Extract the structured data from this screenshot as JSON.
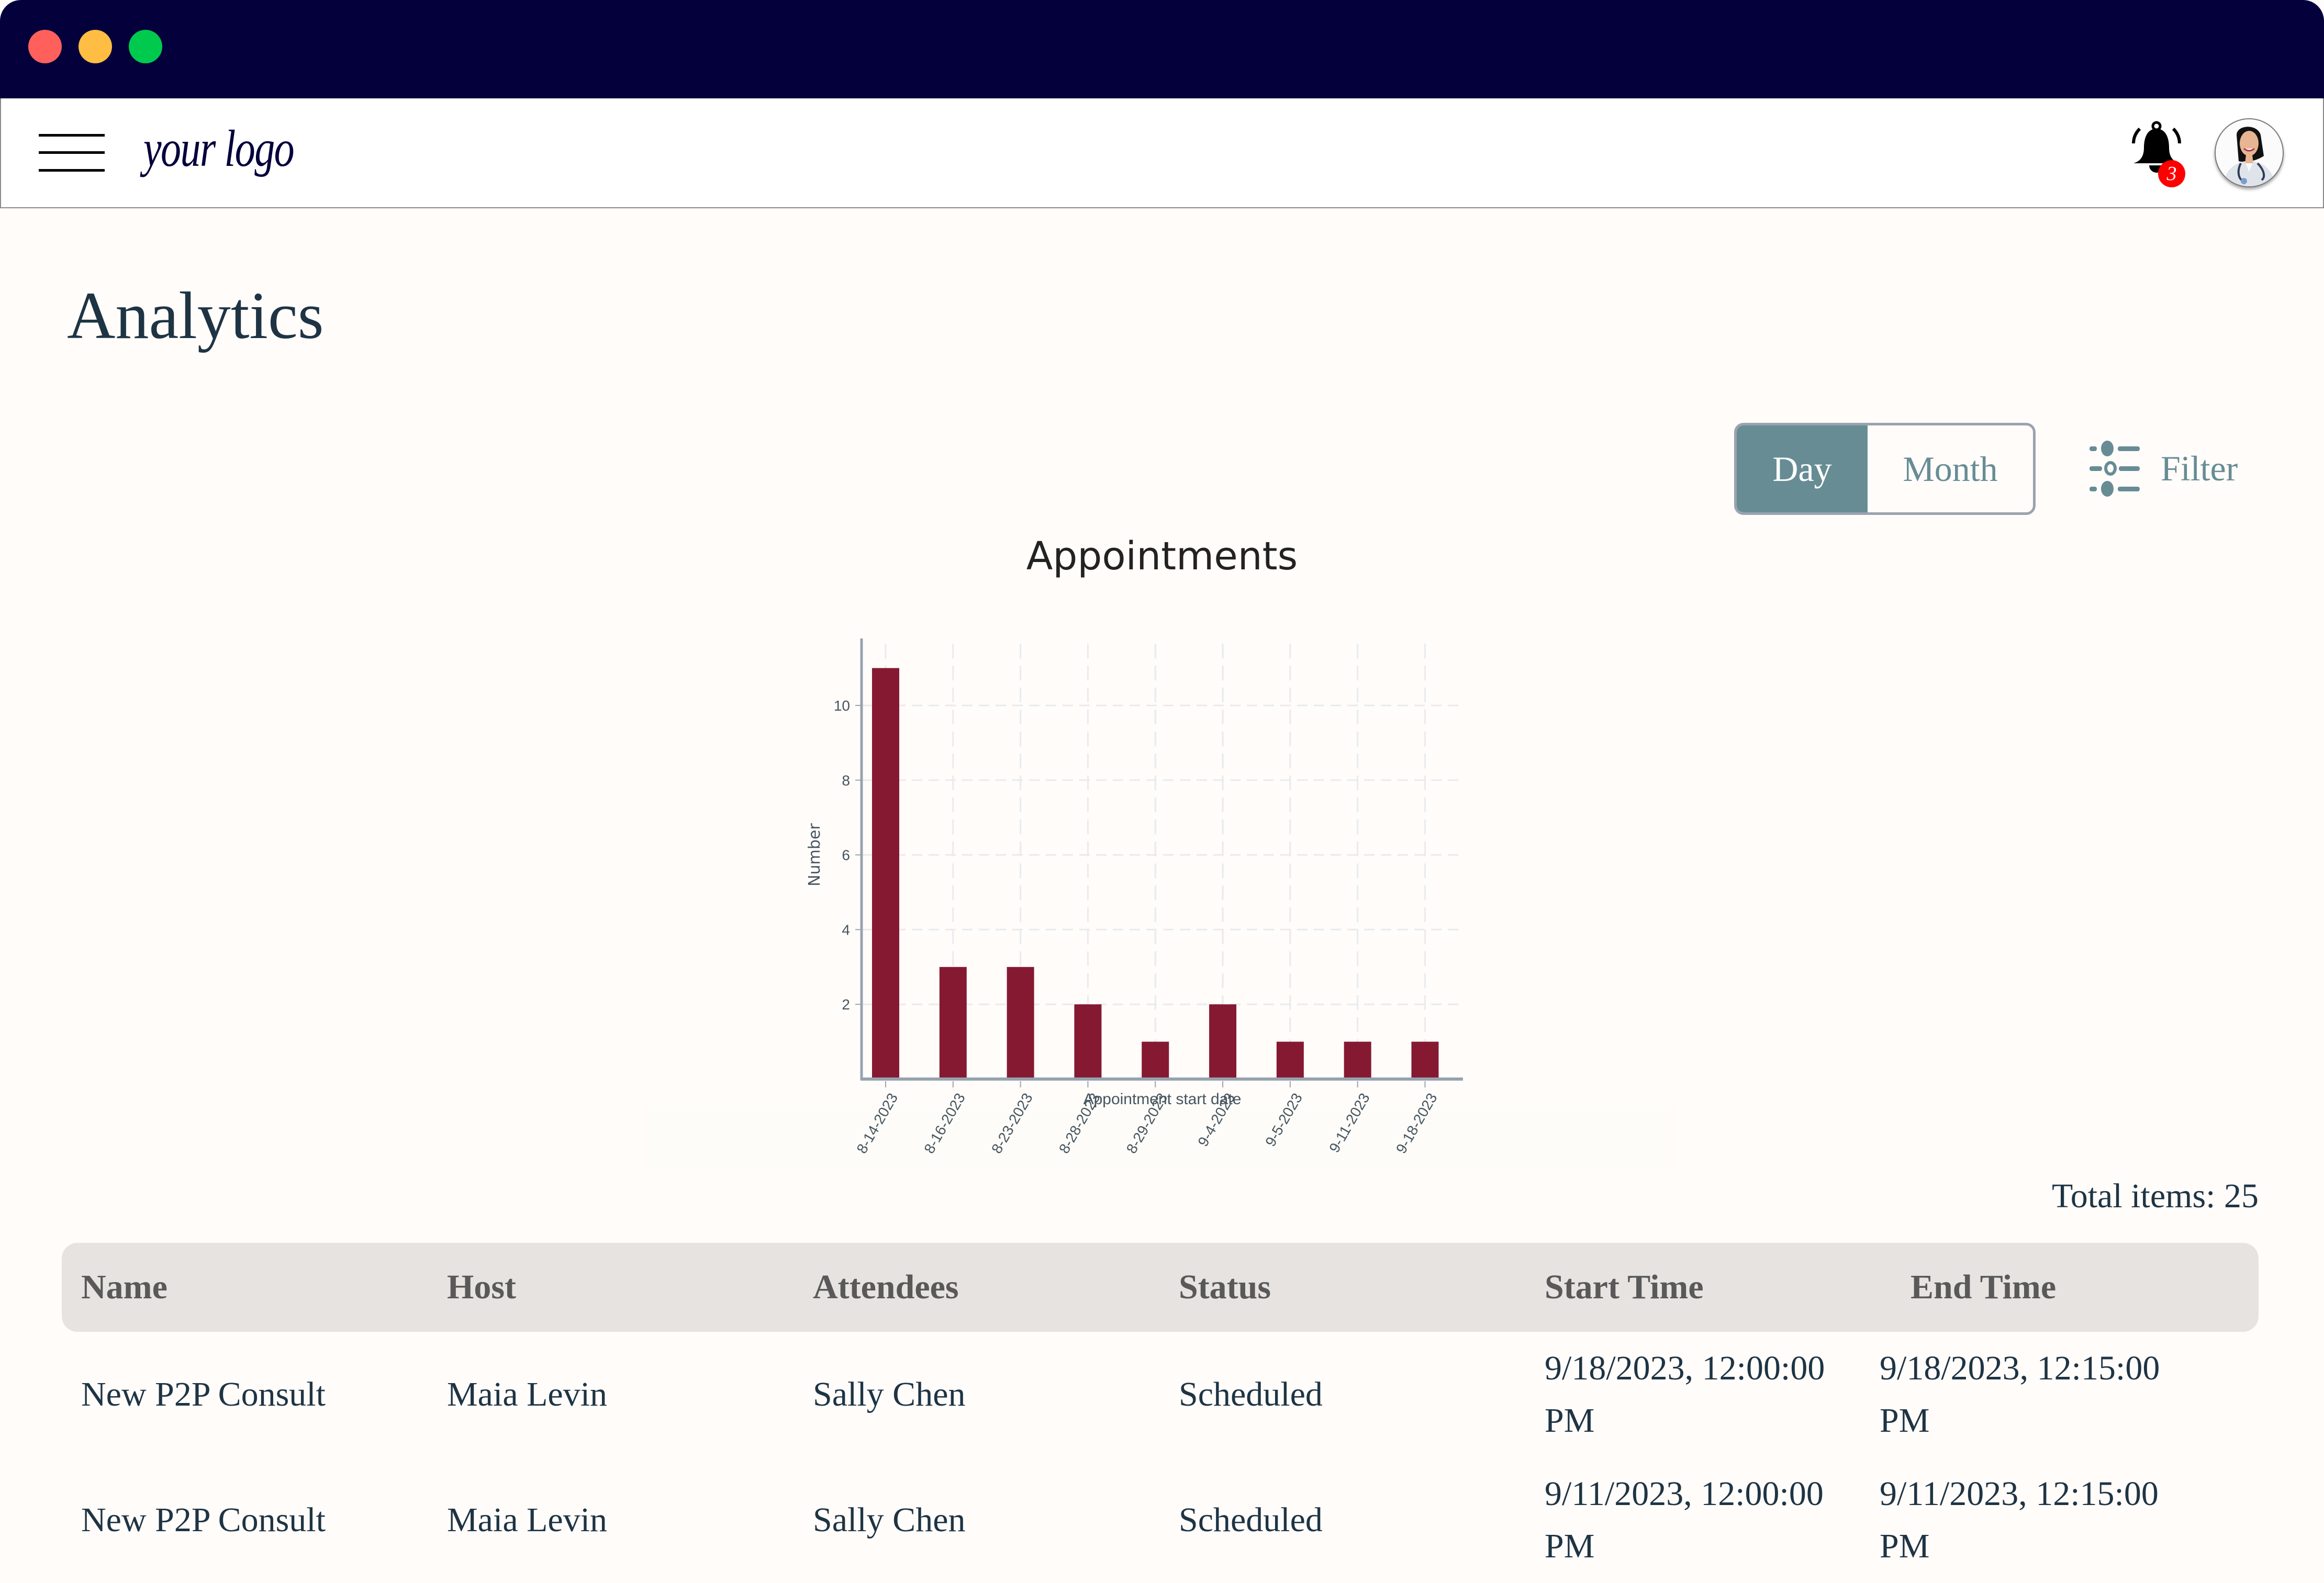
{
  "window": {
    "controls": [
      "close",
      "minimize",
      "maximize"
    ]
  },
  "header": {
    "logo_text": "your logo",
    "menu_icon": "hamburger-menu-icon",
    "notifications": {
      "icon": "bell-icon",
      "count": "3"
    },
    "avatar": {
      "icon": "doctor-avatar"
    }
  },
  "page": {
    "title": "Analytics"
  },
  "view_toggle": {
    "options": [
      "Day",
      "Month"
    ],
    "selected": "Day"
  },
  "filter": {
    "label": "Filter",
    "icon": "sliders-icon"
  },
  "colors": {
    "titlebar": "#03003c",
    "accent": "#678c94",
    "bar": "#861932",
    "badge": "#ff0000",
    "table_header_bg": "#e6e3e1",
    "text": "#1e3444"
  },
  "chart_data": {
    "type": "bar",
    "title": "Appointments",
    "xlabel": "Appointment start date",
    "ylabel": "Number",
    "categories": [
      "8-14-2023",
      "8-16-2023",
      "8-23-2023",
      "8-28-2023",
      "8-29-2023",
      "9-4-2023",
      "9-5-2023",
      "9-11-2023",
      "9-18-2023"
    ],
    "values": [
      11,
      3,
      3,
      2,
      1,
      2,
      1,
      1,
      1
    ],
    "yticks": [
      2,
      4,
      6,
      8,
      10
    ],
    "ylim": [
      0,
      11.8
    ],
    "grid": true,
    "grid_style": "dashed",
    "xtick_rotation": "diagonal"
  },
  "table": {
    "total_label": "Total items: 25",
    "columns": [
      "Name",
      "Host",
      "Attendees",
      "Status",
      "Start Time",
      "End Time"
    ],
    "rows": [
      [
        "New P2P Consult",
        "Maia Levin",
        "Sally Chen",
        "Scheduled",
        "9/18/2023, 12:00:00 PM",
        "9/18/2023, 12:15:00 PM"
      ],
      [
        "New P2P Consult",
        "Maia Levin",
        "Sally Chen",
        "Scheduled",
        "9/11/2023, 12:00:00 PM",
        "9/11/2023, 12:15:00 PM"
      ]
    ]
  }
}
